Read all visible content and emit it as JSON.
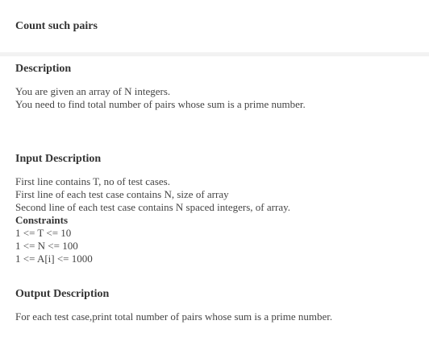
{
  "problem": {
    "title": "Count such pairs"
  },
  "description": {
    "heading": "Description",
    "lines": [
      "You are given an array of N integers.",
      "You need to find total number of pairs whose sum is a prime number."
    ]
  },
  "input_description": {
    "heading": "Input Description",
    "lines": [
      "First line contains T, no of test cases.",
      "First line of each test case contains N, size of array",
      "Second line of each test case contains N spaced integers, of array."
    ],
    "constraints_heading": "Constraints",
    "constraints": [
      "1 <= T <= 10",
      "1 <= N <= 100",
      "1 <= A[i] <= 1000"
    ]
  },
  "output_description": {
    "heading": "Output Description",
    "lines": [
      "For each test case,print total number of pairs whose sum is a prime number."
    ]
  }
}
